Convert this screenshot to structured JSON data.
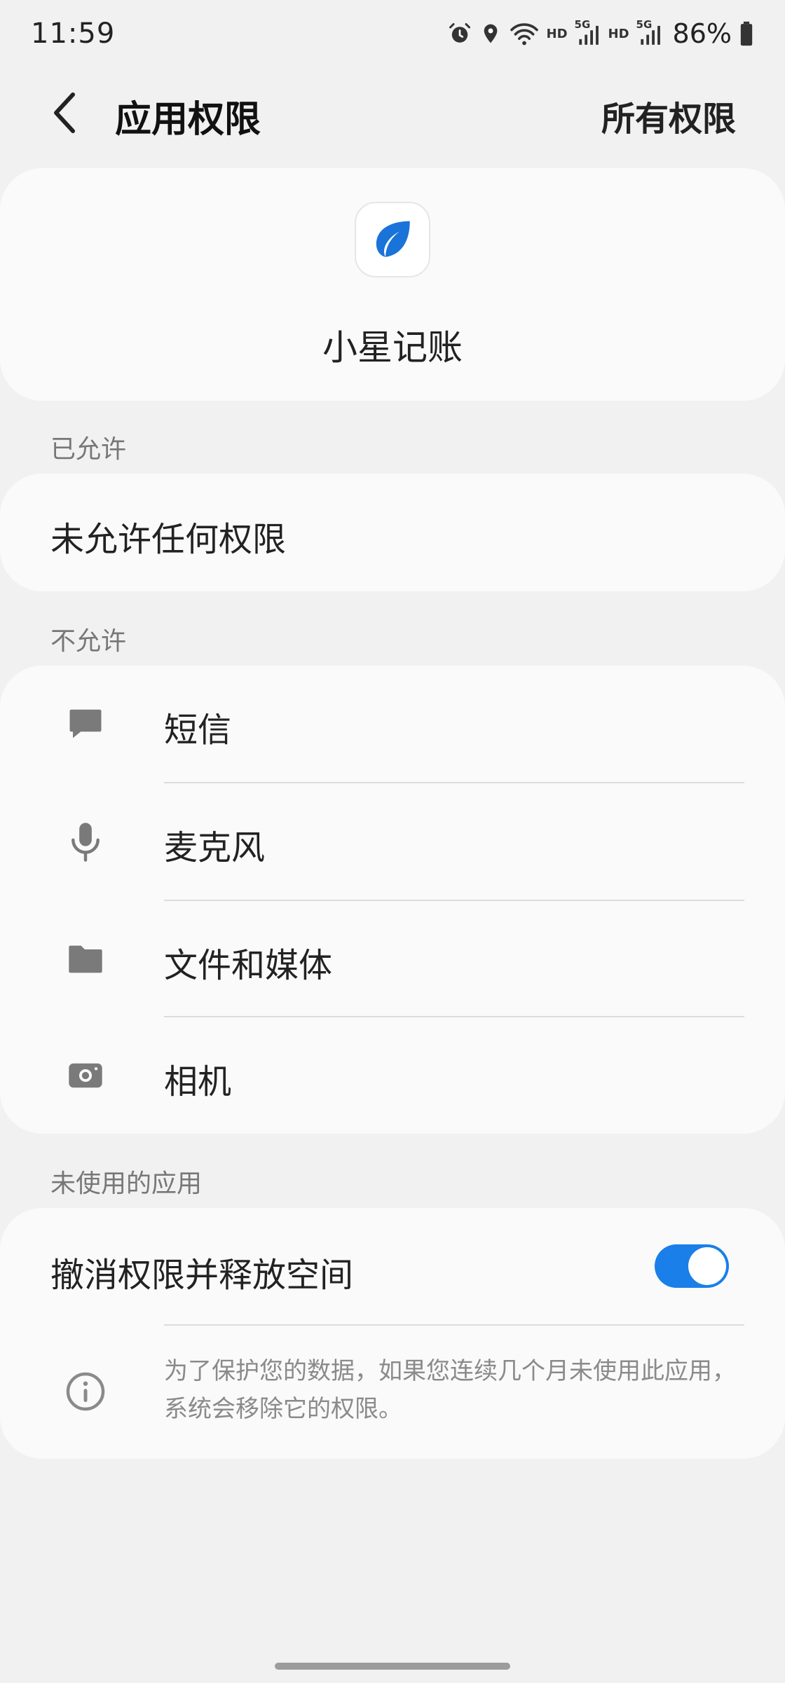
{
  "status_bar": {
    "time": "11:59",
    "hd1": "HD",
    "net1": "5G",
    "hd2": "HD",
    "net2": "5G",
    "battery": "86%"
  },
  "header": {
    "title": "应用权限",
    "all_permissions": "所有权限",
    "back_icon": "chevron-left-icon"
  },
  "app": {
    "name": "小星记账",
    "icon": "leaf-icon",
    "icon_color": "#1a73d8"
  },
  "allowed": {
    "section_label": "已允许",
    "empty_text": "未允许任何权限"
  },
  "denied": {
    "section_label": "不允许",
    "items": [
      {
        "label": "短信",
        "icon": "message-icon"
      },
      {
        "label": "麦克风",
        "icon": "microphone-icon"
      },
      {
        "label": "文件和媒体",
        "icon": "folder-icon"
      },
      {
        "label": "相机",
        "icon": "camera-icon"
      }
    ]
  },
  "unused": {
    "section_label": "未使用的应用",
    "revoke_label": "撤消权限并释放空间",
    "toggle_on": true,
    "toggle_color": "#1a7fe8",
    "info_text": "为了保护您的数据，如果您连续几个月未使用此应用，系统会移除它的权限。"
  }
}
